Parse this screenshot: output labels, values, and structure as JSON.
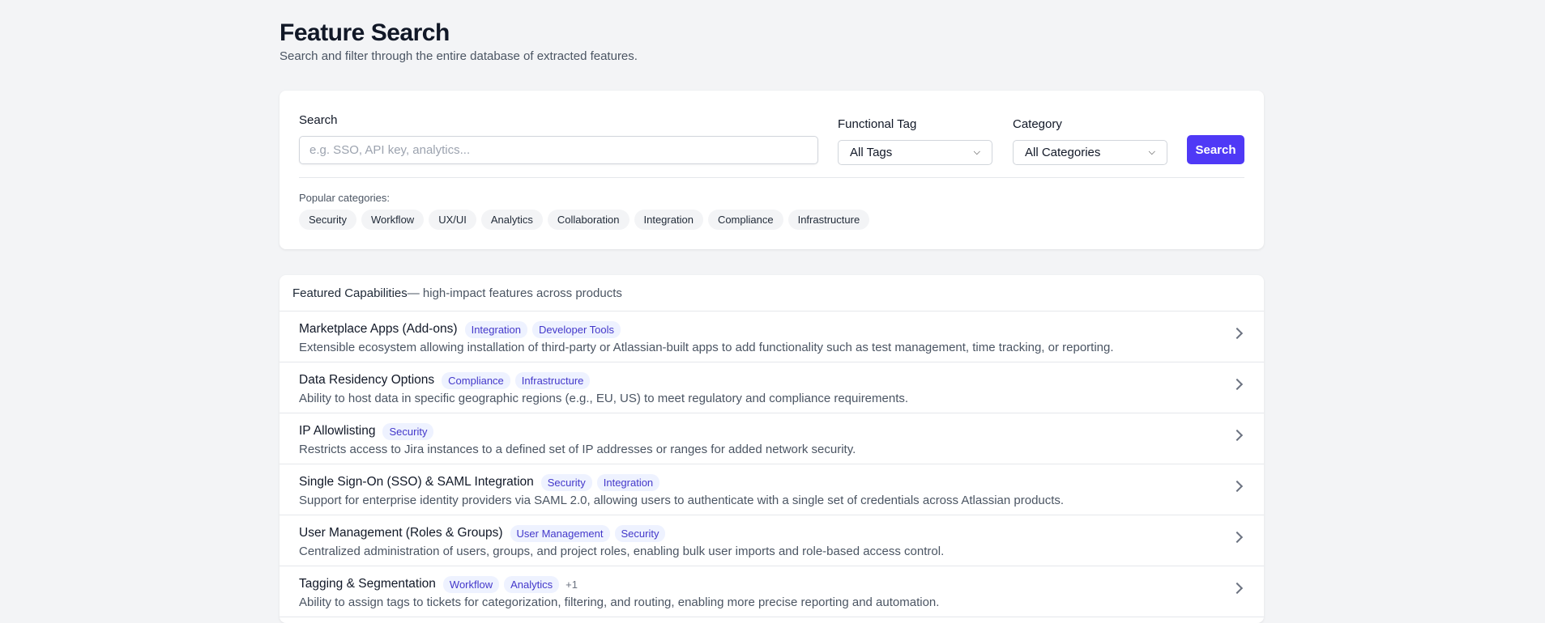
{
  "header": {
    "title": "Feature Search",
    "subtitle": "Search and filter through the entire database of extracted features."
  },
  "search": {
    "label": "Search",
    "placeholder": "e.g. SSO, API key, analytics...",
    "value": "",
    "tag_label": "Functional Tag",
    "tag_value": "All Tags",
    "category_label": "Category",
    "category_value": "All Categories",
    "button": "Search",
    "popular_label": "Popular categories:",
    "popular": [
      "Security",
      "Workflow",
      "UX/UI",
      "Analytics",
      "Collaboration",
      "Integration",
      "Compliance",
      "Infrastructure"
    ]
  },
  "featured": {
    "title": "Featured Capabilities",
    "subtitle": " — high-impact features across products",
    "items": [
      {
        "title": "Marketplace Apps (Add-ons)",
        "tags": [
          "Integration",
          "Developer Tools"
        ],
        "more": "",
        "desc": "Extensible ecosystem allowing installation of third-party or Atlassian-built apps to add functionality such as test management, time tracking, or reporting."
      },
      {
        "title": "Data Residency Options",
        "tags": [
          "Compliance",
          "Infrastructure"
        ],
        "more": "",
        "desc": "Ability to host data in specific geographic regions (e.g., EU, US) to meet regulatory and compliance requirements."
      },
      {
        "title": "IP Allowlisting",
        "tags": [
          "Security"
        ],
        "more": "",
        "desc": "Restricts access to Jira instances to a defined set of IP addresses or ranges for added network security."
      },
      {
        "title": "Single Sign-On (SSO) & SAML Integration",
        "tags": [
          "Security",
          "Integration"
        ],
        "more": "",
        "desc": "Support for enterprise identity providers via SAML 2.0, allowing users to authenticate with a single set of credentials across Atlassian products."
      },
      {
        "title": "User Management (Roles & Groups)",
        "tags": [
          "User Management",
          "Security"
        ],
        "more": "",
        "desc": "Centralized administration of users, groups, and project roles, enabling bulk user imports and role-based access control."
      },
      {
        "title": "Tagging & Segmentation",
        "tags": [
          "Workflow",
          "Analytics"
        ],
        "more": "+1",
        "desc": "Ability to assign tags to tickets for categorization, filtering, and routing, enabling more precise reporting and automation."
      }
    ]
  }
}
